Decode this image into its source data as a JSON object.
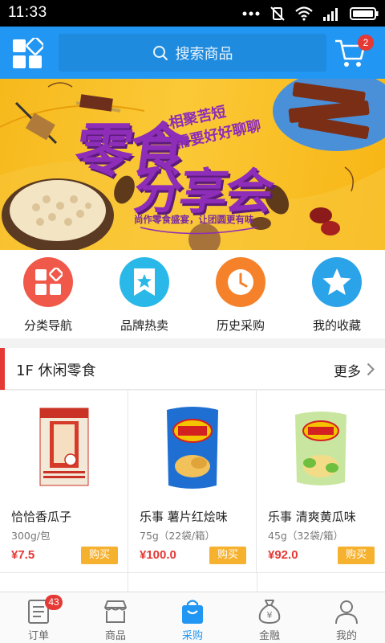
{
  "status_bar": {
    "time": "11:33"
  },
  "header": {
    "search_placeholder": "搜索商品",
    "cart_count": "2"
  },
  "banner": {
    "title_line1": "零食",
    "title_line2": "分享会",
    "tag_line1": "相聚苦短",
    "tag_line2": "需要好好聊聊",
    "subtitle": "尚作零食盛宴，让团圆更有味"
  },
  "quick_nav": [
    {
      "label": "分类导航",
      "icon": "category-icon",
      "color": "#f0584a"
    },
    {
      "label": "品牌热卖",
      "icon": "brand-ribbon-icon",
      "color": "#29b8e8"
    },
    {
      "label": "历史采购",
      "icon": "clock-icon",
      "color": "#f5822a"
    },
    {
      "label": "我的收藏",
      "icon": "star-icon",
      "color": "#2aa3e8"
    }
  ],
  "section": {
    "title": "1F 休闲零食",
    "more": "更多"
  },
  "products": [
    {
      "name": "恰恰香瓜子",
      "spec": "300g/包",
      "price": "¥7.5",
      "buy": "购买"
    },
    {
      "name": "乐事 薯片红烩味",
      "spec": "75g（22袋/箱）",
      "price": "¥100.0",
      "buy": "购买"
    },
    {
      "name": "乐事 清爽黄瓜味",
      "spec": "45g（32袋/箱）",
      "price": "¥92.0",
      "buy": "购买"
    }
  ],
  "tabs": [
    {
      "label": "订单",
      "icon": "order-icon",
      "badge": "43"
    },
    {
      "label": "商品",
      "icon": "shop-icon"
    },
    {
      "label": "采购",
      "icon": "shopping-bag-icon",
      "active": true
    },
    {
      "label": "金融",
      "icon": "money-bag-icon"
    },
    {
      "label": "我的",
      "icon": "user-icon"
    }
  ],
  "colors": {
    "primary": "#2196f3",
    "accent_red": "#e53935",
    "buy_button": "#f6b22e"
  }
}
